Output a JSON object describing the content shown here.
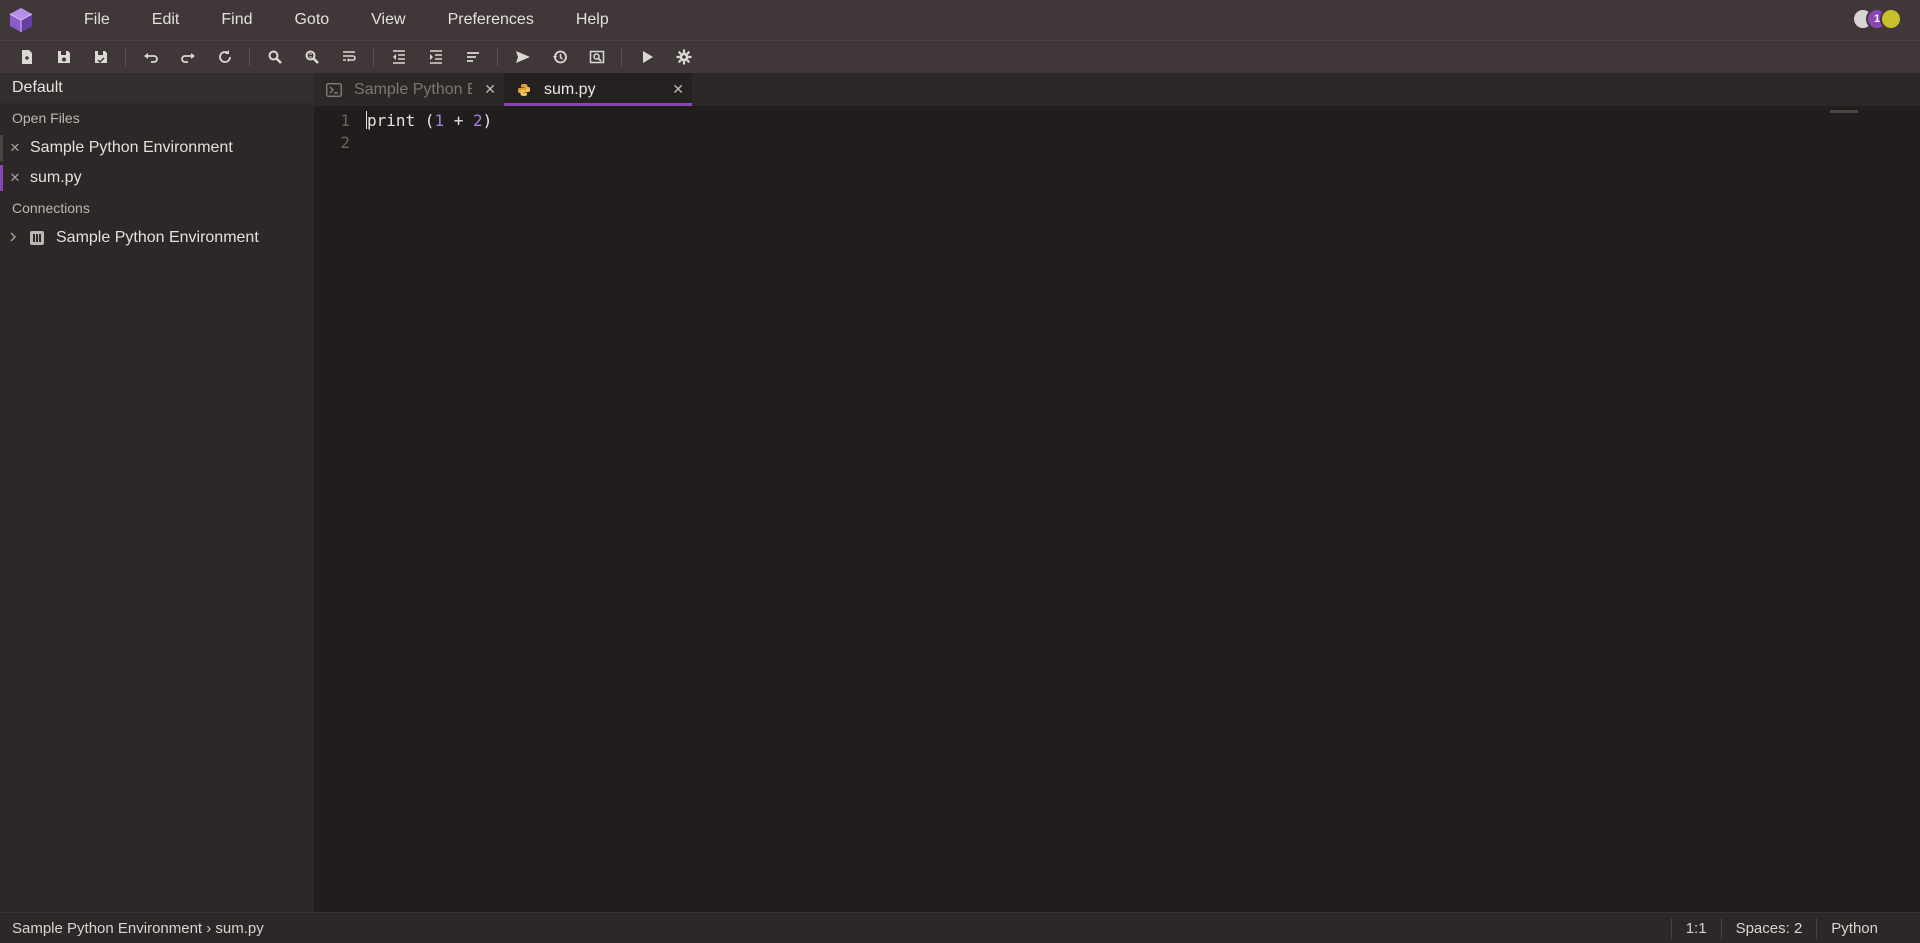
{
  "menubar": {
    "items": [
      "File",
      "Edit",
      "Find",
      "Goto",
      "View",
      "Preferences",
      "Help"
    ],
    "notification_count": "1"
  },
  "toolbar": {
    "buttons": [
      "new-file-icon",
      "save-icon",
      "save-all-icon",
      "undo-icon",
      "redo-icon",
      "refresh-icon",
      "search-icon",
      "search-replace-icon",
      "wrap-icon",
      "indent-left-icon",
      "indent-right-icon",
      "format-icon",
      "send-icon",
      "history-icon",
      "preview-icon",
      "run-icon",
      "settings-icon"
    ]
  },
  "sidebar": {
    "workspace": "Default",
    "open_files_header": "Open Files",
    "open_files": [
      {
        "label": "Sample Python Environment",
        "close": "✕"
      },
      {
        "label": "sum.py",
        "close": "✕"
      }
    ],
    "connections_header": "Connections",
    "connections": [
      {
        "label": "Sample Python Environment"
      }
    ]
  },
  "tabs": [
    {
      "label": "Sample Python E",
      "close": "✕",
      "icon": "terminal-icon"
    },
    {
      "label": "sum.py",
      "close": "✕",
      "icon": "python-icon"
    }
  ],
  "editor": {
    "line_numbers": [
      "1",
      "2"
    ],
    "code_line1": {
      "kw": "print",
      "open": " (",
      "n1": "1",
      "op": " + ",
      "n2": "2",
      "close": ")"
    }
  },
  "statusbar": {
    "breadcrumb": "Sample Python Environment › sum.py",
    "position": "1:1",
    "indent": "Spaces: 2",
    "language": "Python"
  },
  "colors": {
    "accent": "#8c46b4",
    "number": "#a77fd6"
  }
}
